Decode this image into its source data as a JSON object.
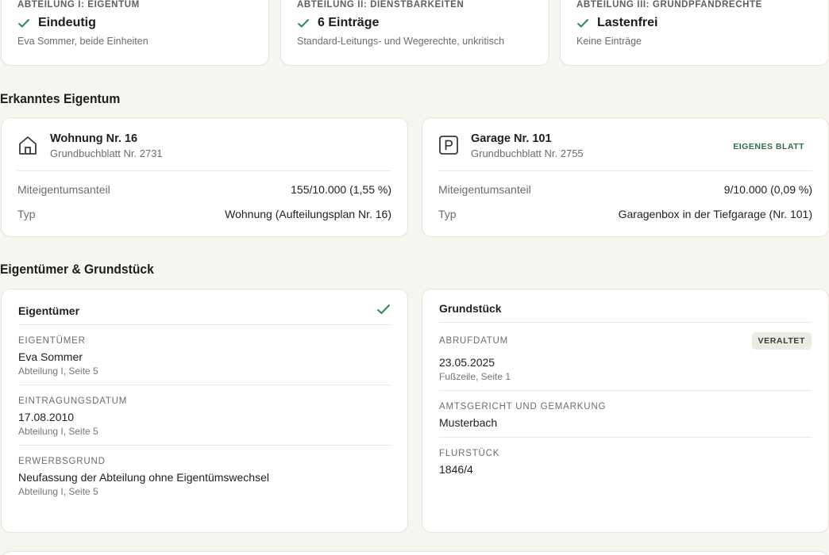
{
  "summary": [
    {
      "heading": "ABTEILUNG I: EIGENTUM",
      "status": "Eindeutig",
      "note": "Eva Sommer, beide Einheiten"
    },
    {
      "heading": "ABTEILUNG II: DIENSTBARKEITEN",
      "status": "6 Einträge",
      "note": "Standard-Leitungs- und Wegerechte, unkritisch"
    },
    {
      "heading": "ABTEILUNG III: GRUNDPFANDRECHTE",
      "status": "Lastenfrei",
      "note": "Keine Einträge"
    }
  ],
  "sections": {
    "property_title": "Erkanntes Eigentum",
    "owner_title": "Eigentümer & Grundstück"
  },
  "properties": [
    {
      "icon": "home-icon",
      "title": "Wohnung Nr. 16",
      "subtitle": "Grundbuchblatt Nr. 2731",
      "badge": "",
      "share_label": "Miteigentumsanteil",
      "share_value": "155/10.000 (1,55 %)",
      "type_label": "Typ",
      "type_value": "Wohnung (Aufteilungsplan Nr. 16)"
    },
    {
      "icon": "parking-icon",
      "title": "Garage Nr. 101",
      "subtitle": "Grundbuchblatt Nr. 2755",
      "badge": "EIGENES BLATT",
      "share_label": "Miteigentumsanteil",
      "share_value": "9/10.000 (0,09 %)",
      "type_label": "Typ",
      "type_value": "Garagenbox in der Tiefgarage (Nr. 101)"
    }
  ],
  "owner": {
    "title": "Eigentümer",
    "fields": [
      {
        "label": "EIGENTÜMER",
        "value": "Eva Sommer",
        "source": "Abteilung I, Seite 5"
      },
      {
        "label": "EINTRAGUNGSDATUM",
        "value": "17.08.2010",
        "source": "Abteilung I, Seite 5"
      },
      {
        "label": "ERWERBSGRUND",
        "value": "Neufassung der Abteilung ohne Eigentümswechsel",
        "source": "Abteilung I, Seite 5"
      }
    ]
  },
  "plot": {
    "title": "Grundstück",
    "fields": [
      {
        "label": "ABRUFDATUM",
        "value": "23.05.2025",
        "source": "Fußzeile, Seite 1",
        "badge": "VERALTET"
      },
      {
        "label": "AMTSGERICHT UND GEMARKUNG",
        "value": "Musterbach"
      },
      {
        "label": "FLURSTÜCK",
        "value": "1846/4"
      }
    ]
  },
  "colors": {
    "check": "#2f8a57",
    "background": "#f6f5ef",
    "badge_green": "#2f6f4a"
  }
}
